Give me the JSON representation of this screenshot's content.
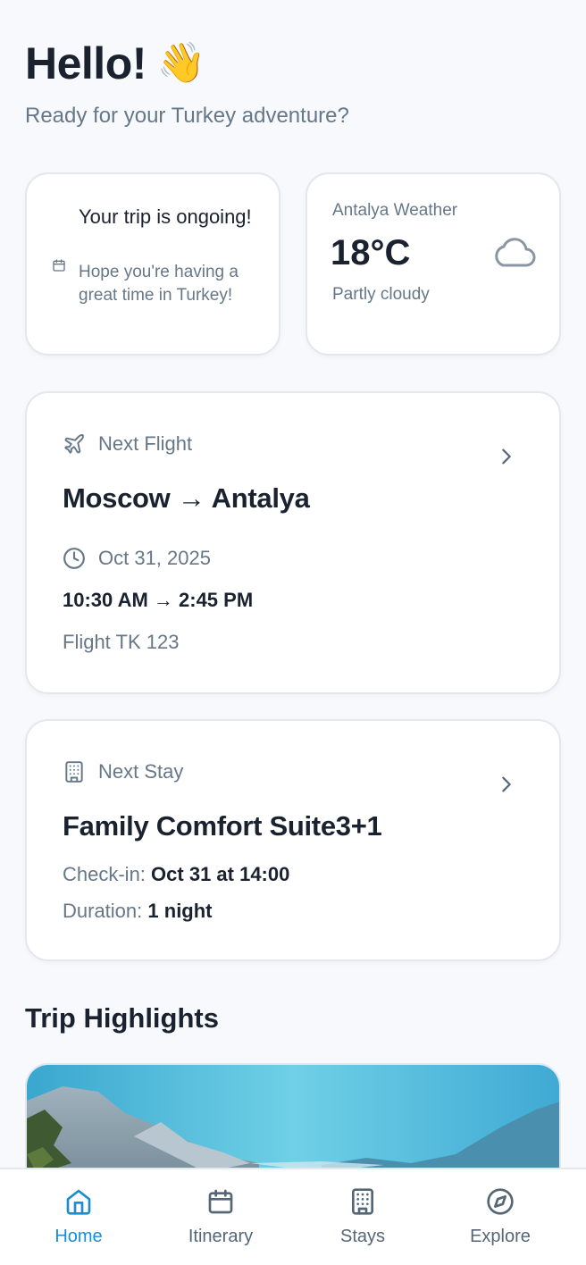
{
  "greeting": {
    "title": "Hello!",
    "emoji": "👋",
    "subtitle": "Ready for your Turkey adventure?"
  },
  "trip_status": {
    "icon": "calendar-icon",
    "title": "Your trip is ongoing!",
    "message": "Hope you're having a great time in Turkey!"
  },
  "weather": {
    "label": "Antalya Weather",
    "temperature": "18°C",
    "condition": "Partly cloudy",
    "icon": "cloud-icon"
  },
  "next_flight": {
    "header": "Next Flight",
    "icon": "plane-icon",
    "route": "Moscow → Antalya",
    "date": "Oct 31, 2025",
    "time": "10:30 AM → 2:45 PM",
    "flight_number": "Flight TK 123"
  },
  "next_stay": {
    "header": "Next Stay",
    "icon": "building-icon",
    "name": "Family Comfort Suite3+1",
    "checkin_label": "Check-in:",
    "checkin_value": "Oct 31 at 14:00",
    "duration_label": "Duration:",
    "duration_value": "1 night"
  },
  "highlights": {
    "title": "Trip Highlights"
  },
  "tabbar": {
    "active": "Home",
    "active_color": "#1b8ed0",
    "tabs": [
      {
        "label": "Home",
        "icon": "home-icon"
      },
      {
        "label": "Itinerary",
        "icon": "calendar-icon"
      },
      {
        "label": "Stays",
        "icon": "building-icon"
      },
      {
        "label": "Explore",
        "icon": "compass-icon"
      }
    ]
  }
}
